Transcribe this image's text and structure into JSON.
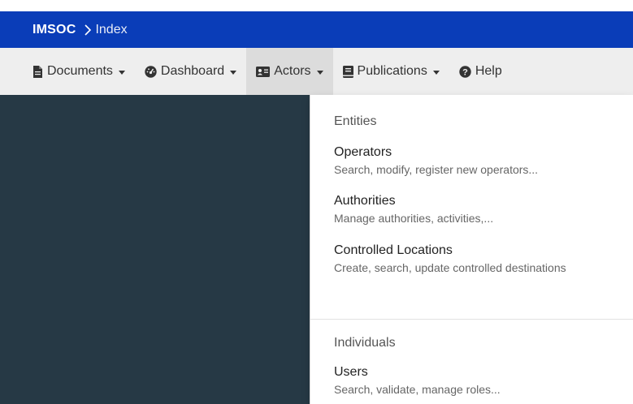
{
  "topbar": {
    "brand": "IMSOC",
    "breadcrumb": "Index"
  },
  "navbar": {
    "items": [
      {
        "label": "Documents",
        "icon": "document-icon"
      },
      {
        "label": "Dashboard",
        "icon": "dashboard-icon"
      },
      {
        "label": "Actors",
        "icon": "id-card-icon"
      },
      {
        "label": "Publications",
        "icon": "book-icon"
      },
      {
        "label": "Help",
        "icon": "question-circle-icon"
      }
    ]
  },
  "dropdown": {
    "sections": [
      {
        "header": "Entities",
        "entries": [
          {
            "title": "Operators",
            "description": "Search, modify, register new operators..."
          },
          {
            "title": "Authorities",
            "description": "Manage authorities, activities,..."
          },
          {
            "title": "Controlled Locations",
            "description": "Create, search, update controlled destinations"
          }
        ]
      },
      {
        "header": "Individuals",
        "entries": [
          {
            "title": "Users",
            "description": "Search, validate, manage roles..."
          }
        ]
      }
    ]
  },
  "colors": {
    "topbar": "#0a3db8",
    "navbar": "#eeeeee",
    "sidepanel": "#263945"
  }
}
